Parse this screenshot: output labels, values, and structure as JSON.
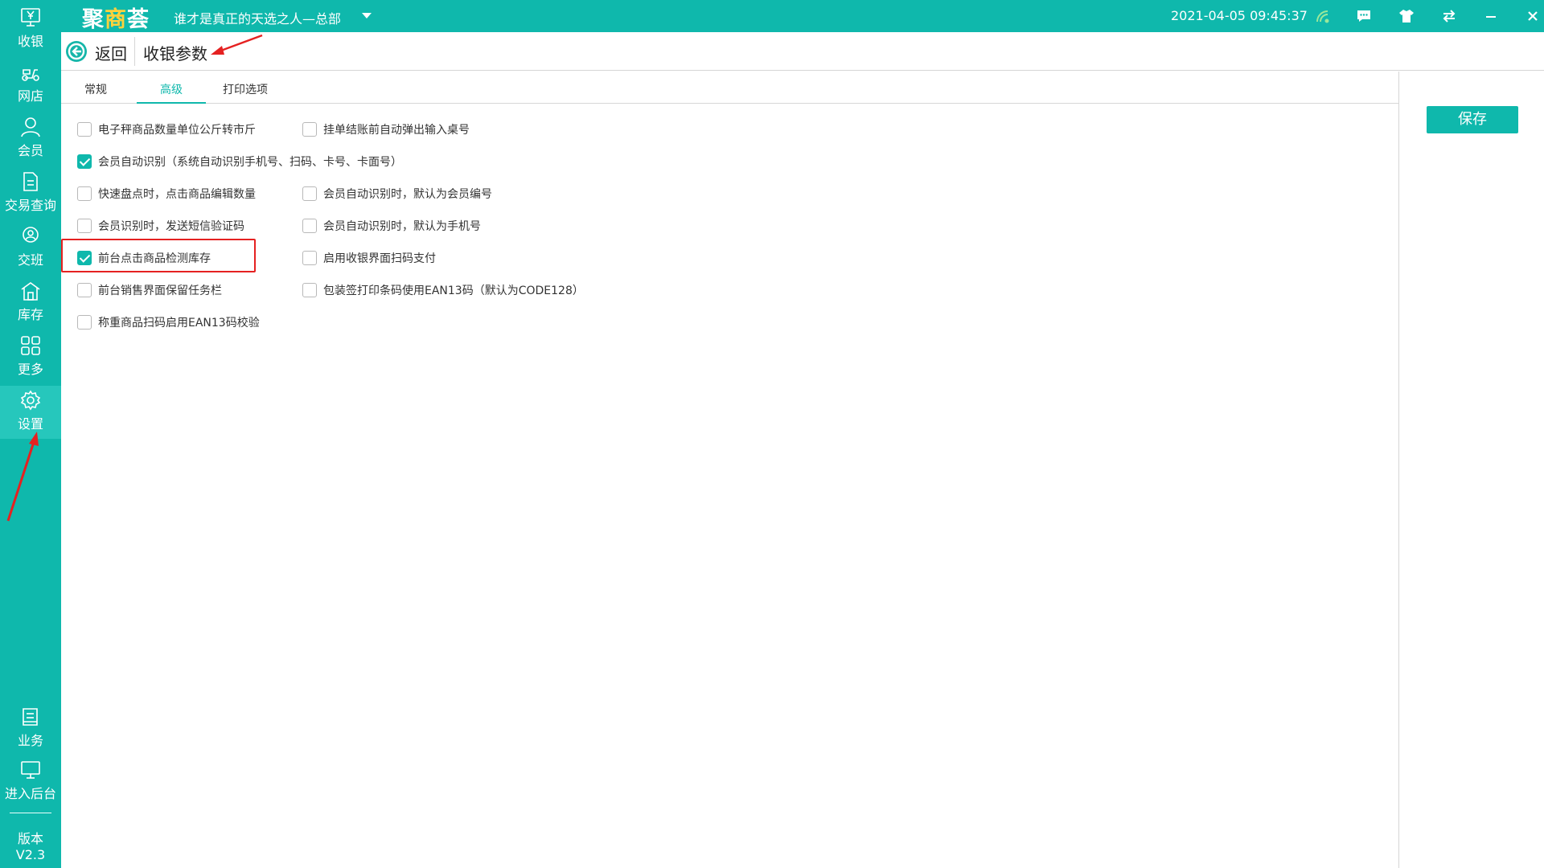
{
  "topbar": {
    "logo_a": "聚",
    "logo_b": "商",
    "logo_c": "荟",
    "store_name": "谁才是真正的天选之人—总部",
    "datetime": "2021-04-05 09:45:37",
    "icons": [
      "wifi-icon",
      "message-icon",
      "shirt-icon",
      "switch-icon",
      "minimize-icon",
      "close-icon"
    ]
  },
  "sidebar": {
    "items": [
      {
        "label": "收银",
        "icon": "cashier-icon"
      },
      {
        "label": "网店",
        "icon": "scooter-icon"
      },
      {
        "label": "会员",
        "icon": "member-icon"
      },
      {
        "label": "交易查询",
        "icon": "document-icon"
      },
      {
        "label": "交班",
        "icon": "handover-icon"
      },
      {
        "label": "库存",
        "icon": "warehouse-icon"
      },
      {
        "label": "更多",
        "icon": "grid-icon"
      },
      {
        "label": "设置",
        "icon": "gear-icon"
      }
    ],
    "bottom_items": [
      {
        "label": "业务",
        "icon": "book-icon"
      },
      {
        "label": "进入后台",
        "icon": "monitor-icon"
      }
    ],
    "version_label": "版本",
    "version": "V2.3",
    "active": "设置"
  },
  "header": {
    "back_label": "返回",
    "title": "收银参数"
  },
  "tabs": [
    {
      "label": "常规",
      "active": false
    },
    {
      "label": "高级",
      "active": true
    },
    {
      "label": "打印选项",
      "active": false
    }
  ],
  "save_label": "保存",
  "options": {
    "left": [
      {
        "label": "电子秤商品数量单位公斤转市斤",
        "checked": false
      },
      {
        "label": "会员自动识别（系统自动识别手机号、扫码、卡号、卡面号）",
        "checked": true
      },
      {
        "label": "快速盘点时，点击商品编辑数量",
        "checked": false
      },
      {
        "label": "会员识别时，发送短信验证码",
        "checked": false
      },
      {
        "label": "前台点击商品检测库存",
        "checked": true
      },
      {
        "label": "前台销售界面保留任务栏",
        "checked": false
      },
      {
        "label": "称重商品扫码启用EAN13码校验",
        "checked": false
      }
    ],
    "right": [
      {
        "label": "挂单结账前自动弹出输入桌号",
        "checked": false
      },
      {
        "label": "会员自动识别时，默认为会员编号",
        "checked": false
      },
      {
        "label": "会员自动识别时，默认为手机号",
        "checked": false
      },
      {
        "label": "启用收银界面扫码支付",
        "checked": false
      },
      {
        "label": "包装签打印条码使用EAN13码（默认为CODE128）",
        "checked": false
      }
    ]
  },
  "colors": {
    "accent": "#0fb8ac",
    "annotation": "#e52121"
  }
}
